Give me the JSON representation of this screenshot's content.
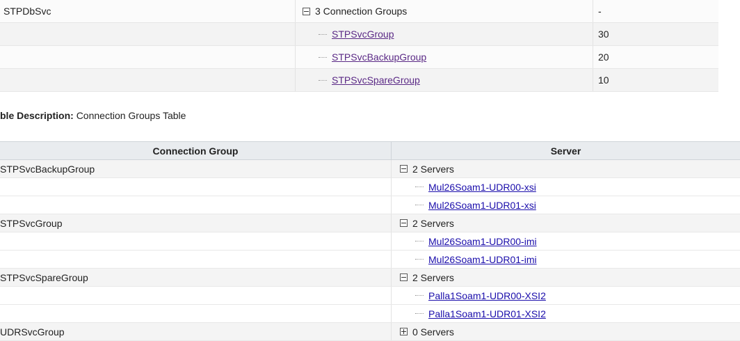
{
  "top_table": {
    "rows": [
      {
        "col1": "STPDbSvc",
        "col2": "3 Connection Groups",
        "col3": "-"
      },
      {
        "col1": "",
        "col2": "STPSvcGroup",
        "col3": "30"
      },
      {
        "col1": "",
        "col2": "STPSvcBackupGroup",
        "col3": "20"
      },
      {
        "col1": "",
        "col2": "STPSvcSpareGroup",
        "col3": "10"
      }
    ]
  },
  "description": {
    "label": "ble Description:",
    "value": "Connection Groups Table"
  },
  "bottom_table": {
    "headers": [
      "Connection Group",
      "Server"
    ],
    "groups": [
      {
        "name": "STPSvcBackupGroup",
        "count": "2 Servers",
        "servers": [
          "Mul26Soam1-UDR00-xsi",
          "Mul26Soam1-UDR01-xsi"
        ]
      },
      {
        "name": "STPSvcGroup",
        "count": "2 Servers",
        "servers": [
          "Mul26Soam1-UDR00-imi",
          "Mul26Soam1-UDR01-imi"
        ]
      },
      {
        "name": "STPSvcSpareGroup",
        "count": "2 Servers",
        "servers": [
          "Palla1Soam1-UDR00-XSI2",
          "Palla1Soam1-UDR01-XSI2"
        ]
      },
      {
        "name": "UDRSvcGroup",
        "count": "0 Servers",
        "servers": []
      }
    ]
  },
  "colors": {
    "link": "#1a0dab",
    "visited_link": "#5b2a86",
    "header_bg": "#e9ecef"
  }
}
